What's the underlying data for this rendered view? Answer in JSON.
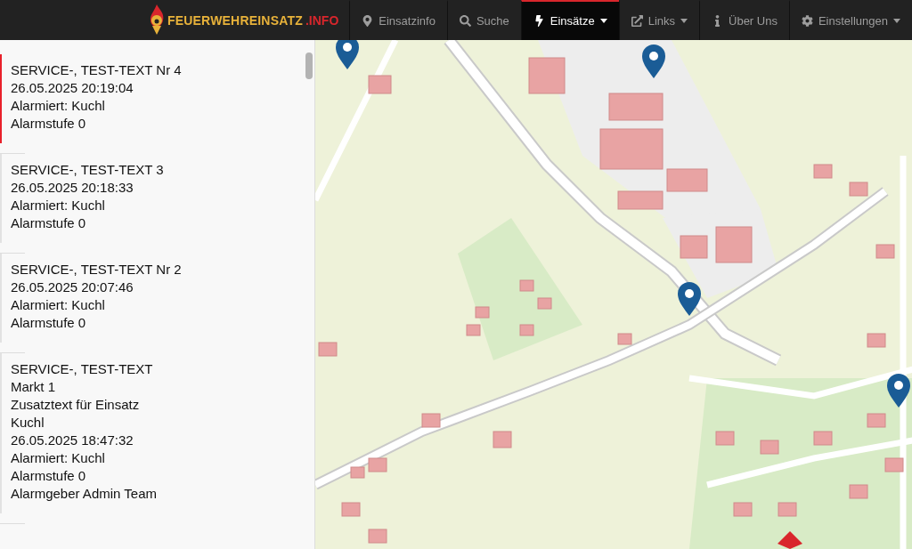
{
  "navbar": {
    "logo": {
      "main": "FEUERWEHREINSATZ",
      "suffix": ".INFO"
    },
    "items": [
      {
        "label": "Einsatzinfo",
        "kind": "pin",
        "dropdown": false,
        "selected": false
      },
      {
        "label": "Suche",
        "kind": "search",
        "dropdown": false,
        "selected": false
      },
      {
        "label": "Einsätze",
        "kind": "bolt",
        "dropdown": true,
        "selected": true
      },
      {
        "label": "Links",
        "kind": "external",
        "dropdown": true,
        "selected": false
      },
      {
        "label": "Über Uns",
        "kind": "info",
        "dropdown": false,
        "selected": false
      },
      {
        "label": "Einstellungen",
        "kind": "gear",
        "dropdown": true,
        "selected": false
      }
    ]
  },
  "incidents": [
    {
      "selected": true,
      "lines": [
        "SERVICE-, TEST-TEXT Nr 4",
        "26.05.2025 20:19:04",
        "Alarmiert: Kuchl",
        "Alarmstufe 0"
      ]
    },
    {
      "selected": false,
      "lines": [
        "SERVICE-, TEST-TEXT 3",
        "26.05.2025 20:18:33",
        "Alarmiert: Kuchl",
        "Alarmstufe 0"
      ]
    },
    {
      "selected": false,
      "lines": [
        "SERVICE-, TEST-TEXT Nr 2",
        "26.05.2025 20:07:46",
        "Alarmiert: Kuchl",
        "Alarmstufe 0"
      ]
    },
    {
      "selected": false,
      "lines": [
        "SERVICE-, TEST-TEXT",
        "Markt 1",
        "Zusatztext für Einsatz",
        "Kuchl",
        "26.05.2025 18:47:32",
        "Alarmiert: Kuchl",
        "Alarmstufe 0",
        "Alarmgeber Admin Team"
      ]
    }
  ]
}
